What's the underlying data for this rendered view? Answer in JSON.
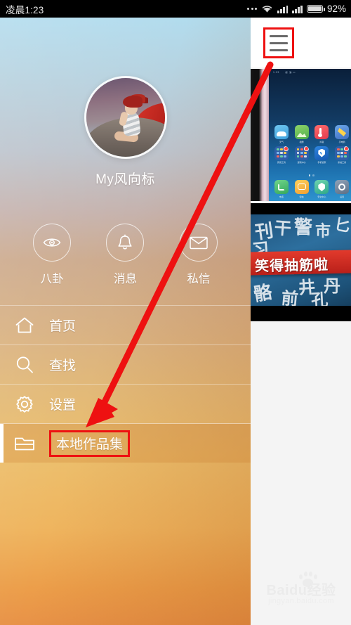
{
  "status_bar": {
    "time": "凌晨1:23",
    "battery_percent": "92%",
    "icons": [
      "more-dots-icon",
      "wifi-icon",
      "signal-icon",
      "signal-icon",
      "battery-icon"
    ]
  },
  "drawer": {
    "profile": {
      "username": "My风向标",
      "avatar_alt": "avatar-image"
    },
    "quick_actions": [
      {
        "label": "八卦",
        "icon": "eye-icon"
      },
      {
        "label": "消息",
        "icon": "bell-icon"
      },
      {
        "label": "私信",
        "icon": "envelope-icon"
      }
    ],
    "menu_items": [
      {
        "label": "首页",
        "icon": "home-icon",
        "active": false,
        "highlighted": false
      },
      {
        "label": "查找",
        "icon": "search-icon",
        "active": false,
        "highlighted": false
      },
      {
        "label": "设置",
        "icon": "gear-icon",
        "active": false,
        "highlighted": false
      },
      {
        "label": "本地作品集",
        "icon": "folder-icon",
        "active": true,
        "highlighted": true
      }
    ]
  },
  "background_page": {
    "menu_button": {
      "icon": "hamburger-menu-icon",
      "highlighted": true
    },
    "thumbnails": [
      {
        "name": "phone-home-screen-photo",
        "caption": ""
      },
      {
        "name": "funny-video-thumbnail",
        "caption": "笑得抽筋啦"
      }
    ],
    "phone_photo": {
      "apps_row1": [
        "天气",
        "相册",
        "抖音",
        "手电筒"
      ],
      "apps_row2": [
        "实用工具",
        "游戏中心",
        "手机管家",
        "系统工具"
      ],
      "dock": [
        "电话",
        "短信",
        "安全中心",
        "设置"
      ]
    }
  },
  "annotation": {
    "arrow_color": "#ee1111",
    "highlight_box_color": "#ee1111",
    "arrow_from": "hamburger-menu-icon",
    "arrow_to": "本地作品集"
  },
  "watermark": {
    "brand": "Baidu经验",
    "url": "jingyan.baidu.com"
  }
}
